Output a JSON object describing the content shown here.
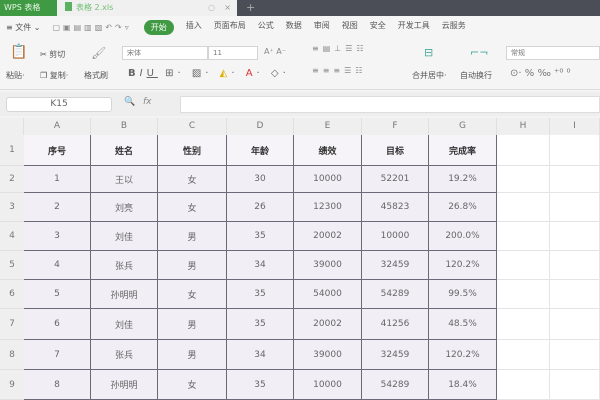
{
  "titlebar": {
    "app_tab": "WPS 表格",
    "file_tab": "表格 2.xls",
    "close": "×",
    "new_tab": "+"
  },
  "menu": {
    "file": "≡ 文件 ⌄",
    "items": [
      "开始",
      "插入",
      "页面布局",
      "公式",
      "数据",
      "审阅",
      "视图",
      "安全",
      "开发工具",
      "云服务"
    ],
    "active_index": 0
  },
  "ribbon": {
    "paste": "粘贴·",
    "cut": "✂ 剪切",
    "copy": "复制·",
    "format_painter": "格式刷",
    "font_name": "宋体",
    "font_size": "11",
    "bold": "B",
    "italic": "I",
    "underline": "U",
    "merge": "合并居中·",
    "wrap": "自动换行",
    "number_format": "常规",
    "percent": "%"
  },
  "formula_bar": {
    "name_box": "K15",
    "fx": "fx",
    "value": ""
  },
  "columns": [
    "A",
    "B",
    "C",
    "D",
    "E",
    "F",
    "G",
    "H",
    "I"
  ],
  "rows": [
    "1",
    "2",
    "3",
    "4",
    "5",
    "6",
    "7",
    "8",
    "9"
  ],
  "table": {
    "headers": [
      "序号",
      "姓名",
      "性别",
      "年龄",
      "绩效",
      "目标",
      "完成率"
    ],
    "data": [
      [
        "1",
        "王以",
        "女",
        "30",
        "10000",
        "52201",
        "19.2%"
      ],
      [
        "2",
        "刘亮",
        "女",
        "26",
        "12300",
        "45823",
        "26.8%"
      ],
      [
        "3",
        "刘佳",
        "男",
        "35",
        "20002",
        "10000",
        "200.0%"
      ],
      [
        "4",
        "张兵",
        "男",
        "34",
        "39000",
        "32459",
        "120.2%"
      ],
      [
        "5",
        "孙明明",
        "女",
        "35",
        "54000",
        "54289",
        "99.5%"
      ],
      [
        "6",
        "刘佳",
        "男",
        "35",
        "20002",
        "41256",
        "48.5%"
      ],
      [
        "7",
        "张兵",
        "男",
        "34",
        "39000",
        "32459",
        "120.2%"
      ],
      [
        "8",
        "孙明明",
        "女",
        "35",
        "10000",
        "54289",
        "18.4%"
      ]
    ]
  },
  "colors": {
    "accent": "#3f9a43",
    "cell_fill": "#f1eef6",
    "border": "#6a6a78"
  }
}
